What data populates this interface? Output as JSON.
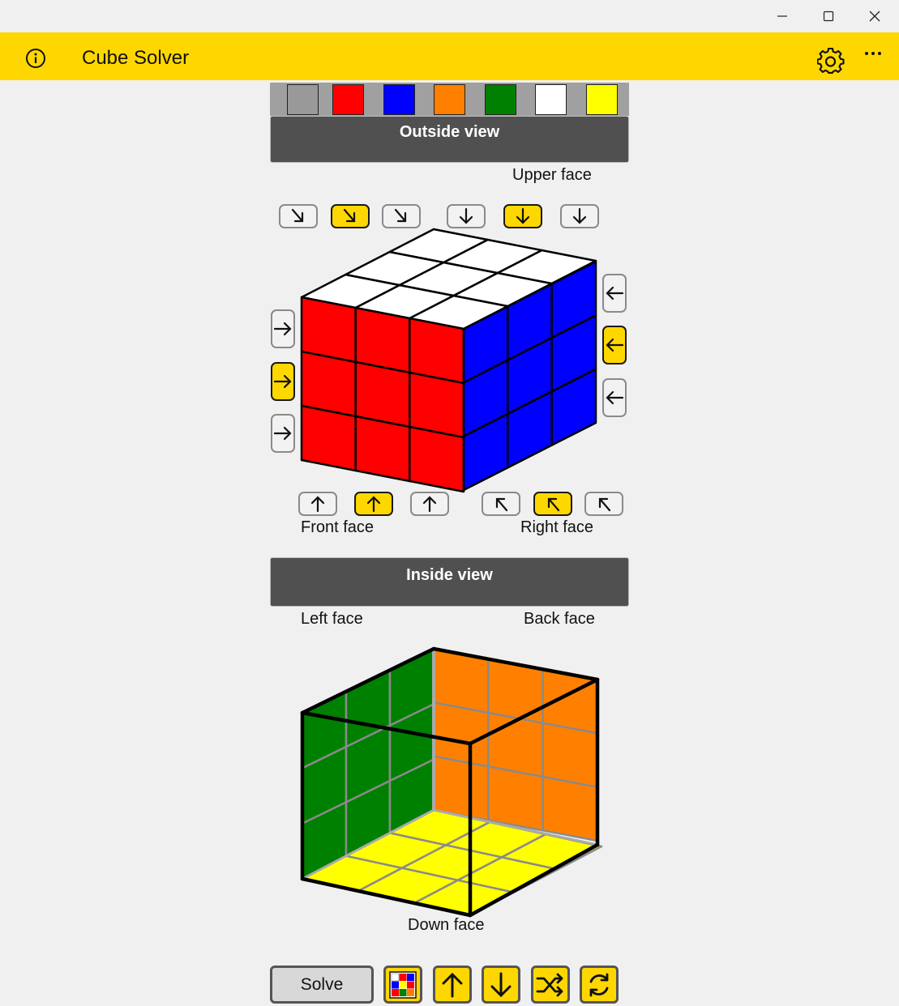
{
  "app": {
    "title": "Cube Solver"
  },
  "colors": {
    "accent": "#ffd700",
    "palette": [
      "#999999",
      "#ff0000",
      "#0000ff",
      "#ff8000",
      "#008000",
      "#ffffff",
      "#ffff00"
    ]
  },
  "outside_view": {
    "header": "Outside view",
    "upper_face_label": "Upper face",
    "front_face_label": "Front face",
    "right_face_label": "Right face",
    "upper_face_color": "#ffffff",
    "front_face_color": "#ff0000",
    "right_face_color": "#0000ff"
  },
  "inside_view": {
    "header": "Inside view",
    "left_face_label": "Left face",
    "back_face_label": "Back face",
    "down_face_label": "Down face",
    "left_face_color": "#008000",
    "back_face_color": "#ff8000",
    "down_face_color": "#ffff00"
  },
  "bottom_bar": {
    "solve_label": "Solve",
    "icons": [
      "color-grid-icon",
      "arrow-up-icon",
      "arrow-down-icon",
      "shuffle-icon",
      "refresh-icon"
    ]
  }
}
